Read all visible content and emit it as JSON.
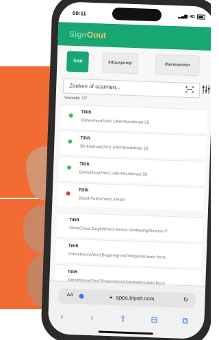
{
  "status": {
    "time": "00:11",
    "network": "4G"
  },
  "app": {
    "logo_part1": "Sign",
    "logo_part2": "Oout"
  },
  "tabs": [
    {
      "label": "Tillift",
      "active": true
    },
    {
      "label": "Infuuspomp",
      "active": false
    },
    {
      "label": "thermometer",
      "active": false
    }
  ],
  "search": {
    "placeholder": "Zoeken of scannen..."
  },
  "count_label": "Vermeld: 7/7",
  "items": [
    {
      "title": "Tillift",
      "subtitle": "Berkenhout/Verd 1/Bernhardstraat 59",
      "status": "ok"
    },
    {
      "title": "Tillift",
      "subtitle": "Berkenhout/Verd 1/Bernhardstraat 59",
      "status": "ok"
    },
    {
      "title": "Tillift",
      "subtitle": "Berkenhout/Verd 1/Bernhardstraat 59",
      "status": "ok"
    },
    {
      "title": "Tillift",
      "subtitle": "Depot Putten/Verd /Depot",
      "status": "alert"
    },
    {
      "title": "Tillift",
      "subtitle": "SilverCloud Zorgloft/Verd Eerste Verdieping/Kantoor F",
      "status": "none"
    },
    {
      "title": "Tillift",
      "subtitle": "Zonnehoeve/Verd Beganegrond/Vergaderruimte bene",
      "status": "none"
    },
    {
      "title": "Tillift",
      "subtitle": "Zonnehoeve/Verd Beganegrond/Vergaderruimte bene",
      "status": "none"
    }
  ],
  "browser": {
    "aa_label": "AA",
    "url": "apps.blyott.com"
  },
  "colors": {
    "accent_green": "#18a672",
    "status_ok": "#35c15b",
    "status_alert": "#e03b3b",
    "background_orange": "#f26b32"
  }
}
